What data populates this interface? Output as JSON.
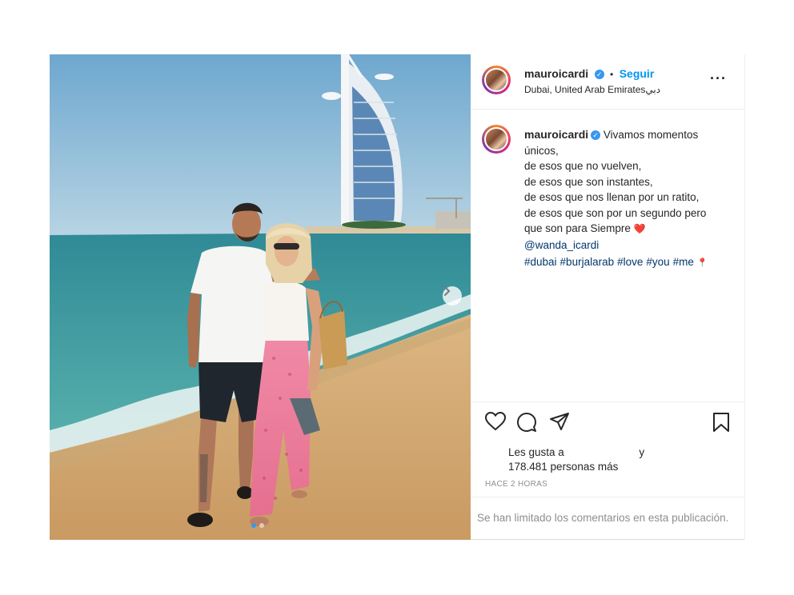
{
  "header": {
    "username": "mauroicardi",
    "verified": "✓",
    "separator": "•",
    "follow_label": "Seguir",
    "location": "Dubai, United Arab Emiratesدبي",
    "more": "···"
  },
  "caption": {
    "username": "mauroicardi",
    "text": "Vivamos momentos\núnicos,\nde esos que no vuelven,\nde esos que son instantes,\nde esos que nos llenan por un ratito,\nde esos que son por un segundo pero\nque son para Siempre",
    "heart": "❤️",
    "mention": "@wanda_icardi",
    "hashtags": [
      "#dubai",
      "#burjalarab",
      "#love",
      "#you",
      "#me"
    ],
    "pin": "📍"
  },
  "actions": {
    "like_icon": "heart-outline-icon",
    "comment_icon": "comment-icon",
    "share_icon": "paper-plane-icon",
    "save_icon": "bookmark-icon"
  },
  "likes": {
    "prefix": "Les gusta a",
    "suffix": "y",
    "count_line": "178.481 personas más"
  },
  "timestamp": "HACE 2 HORAS",
  "comments_notice": "Se han limitado los comentarios en esta publicación.",
  "carousel": {
    "next_icon": "chevron-right-icon",
    "total_slides": 2,
    "active_slide": 1
  },
  "colors": {
    "link": "#0095f6",
    "hashtag": "#00376b",
    "muted": "#8e8e8e",
    "dot_active": "#3897f0"
  }
}
